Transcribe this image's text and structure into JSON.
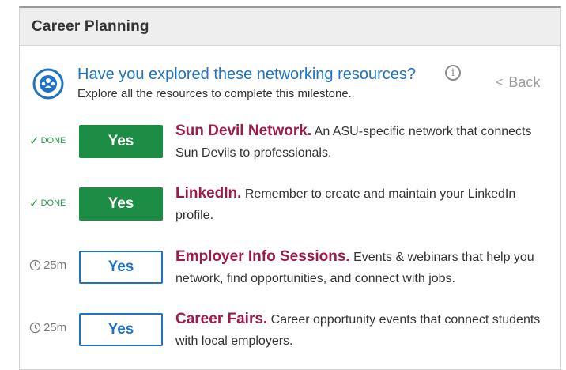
{
  "card": {
    "title": "Career Planning"
  },
  "milestone": {
    "title": "Have you explored these networking resources?",
    "subtitle": "Explore all the resources to complete this milestone.",
    "back_label": "Back",
    "icon": "network-people-icon"
  },
  "resources": [
    {
      "status": "DONE",
      "button": "Yes",
      "name": "Sun Devil Network.",
      "description": "An ASU-specific network that connects Sun Devils to professionals."
    },
    {
      "status": "DONE",
      "button": "Yes",
      "name": "LinkedIn.",
      "description": "Remember to create and maintain your LinkedIn profile."
    },
    {
      "status": "25m",
      "button": "Yes",
      "name": "Employer Info Sessions.",
      "description": "Events & webinars that help you network, find opportunities, and connect with jobs."
    },
    {
      "status": "25m",
      "button": "Yes",
      "name": "Career Fairs.",
      "description": "Career opportunity events that connect students with local employers."
    }
  ],
  "colors": {
    "done_green": "#1d8c45",
    "link_blue": "#1f73c6",
    "resource_maroon": "#9b1b4a",
    "header_gray": "#eeeeee"
  }
}
